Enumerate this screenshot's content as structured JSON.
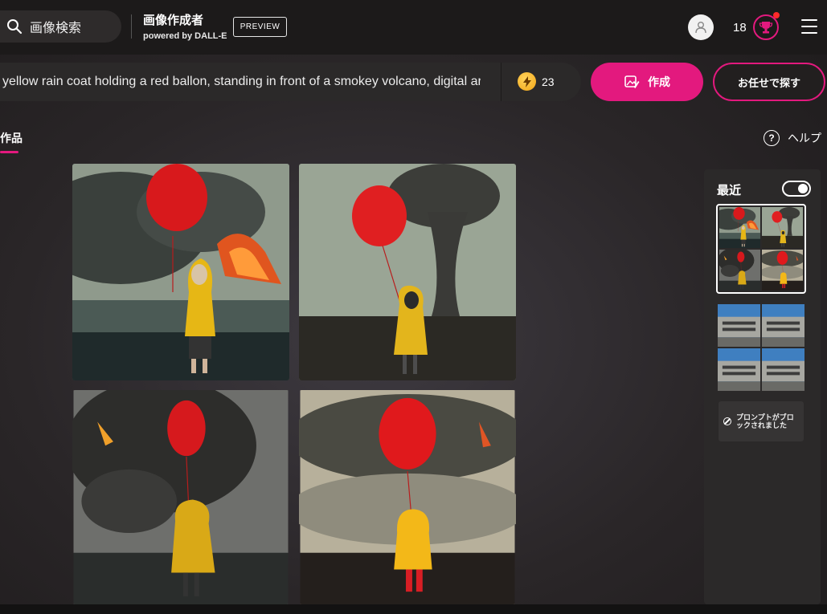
{
  "header": {
    "search_label": "画像検索",
    "app_title": "画像作成者",
    "powered_by": "powered by DALL-E",
    "preview_badge": "PREVIEW",
    "coin_count": "18"
  },
  "prompt": {
    "text": "yellow rain coat holding a red ballon, standing in front of a smokey volcano, digital art",
    "boost_count": "23",
    "create_label": "作成",
    "surprise_label": "お任せで探す"
  },
  "tabs": {
    "creations": "作品",
    "help": "ヘルプ"
  },
  "sidebar": {
    "recent_label": "最近",
    "blocked_text": "プロンプトがブロックされました"
  },
  "colors": {
    "accent": "#e3197e",
    "topbar": "#1c1a1a",
    "panel": "#2b2929"
  },
  "icons": {
    "search": "search-icon",
    "user": "user-icon",
    "reward": "trophy-icon",
    "menu": "hamburger-icon",
    "boost": "lightning-icon",
    "create": "image-edit-icon",
    "help": "question-icon",
    "blocked": "prohibited-icon"
  }
}
